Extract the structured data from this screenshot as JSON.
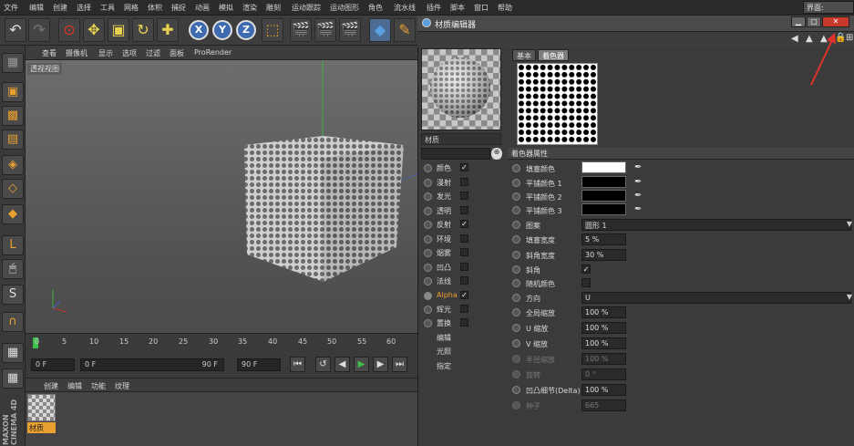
{
  "menubar": {
    "items": [
      "文件",
      "编辑",
      "创建",
      "选择",
      "工具",
      "网格",
      "体积",
      "捕捉",
      "动画",
      "模拟",
      "渲染",
      "雕刻",
      "运动跟踪",
      "运动图形",
      "角色",
      "流水线",
      "插件",
      "脚本",
      "窗口",
      "帮助"
    ],
    "layout_label": "界面:"
  },
  "toolbar": {
    "axis": [
      "X",
      "Y",
      "Z"
    ]
  },
  "viewport": {
    "menu": [
      "查看",
      "摄像机",
      "显示",
      "选项",
      "过滤",
      "面板",
      "ProRender"
    ],
    "label": "透视视图"
  },
  "timeline": {
    "ticks": [
      "0",
      "5",
      "10",
      "15",
      "20",
      "25",
      "30",
      "35",
      "40",
      "45",
      "50",
      "55",
      "60"
    ],
    "start": "0 F",
    "range_start": "0 F",
    "range_end": "90 F",
    "end": "90 F"
  },
  "material_manager": {
    "menu": [
      "创建",
      "编辑",
      "功能",
      "纹理"
    ],
    "material_name": "材质"
  },
  "editor": {
    "title": "材质编辑器",
    "material_name": "材质",
    "tabs": [
      "基本",
      "着色器"
    ],
    "shader_section": "着色器属性",
    "channels": [
      {
        "label": "颜色",
        "checked": true
      },
      {
        "label": "漫射",
        "checked": false
      },
      {
        "label": "发光",
        "checked": false
      },
      {
        "label": "透明",
        "checked": false
      },
      {
        "label": "反射",
        "checked": true
      },
      {
        "label": "环境",
        "checked": false
      },
      {
        "label": "烟雾",
        "checked": false
      },
      {
        "label": "凹凸",
        "checked": false
      },
      {
        "label": "法线",
        "checked": false
      },
      {
        "label": "Alpha",
        "checked": true
      },
      {
        "label": "辉光",
        "checked": false
      },
      {
        "label": "置换",
        "checked": false
      },
      {
        "label": "编辑",
        "checked": null
      },
      {
        "label": "光照",
        "checked": null
      },
      {
        "label": "指定",
        "checked": null
      }
    ],
    "props": [
      {
        "label": "填塞颜色",
        "type": "color",
        "color": "#ffffff"
      },
      {
        "label": "平铺颜色 1",
        "type": "color",
        "color": "#000000"
      },
      {
        "label": "平铺颜色 2",
        "type": "color",
        "color": "#000000"
      },
      {
        "label": "平铺颜色 3",
        "type": "color",
        "color": "#000000"
      },
      {
        "label": "图案",
        "type": "dropdown",
        "value": "圆形 1"
      },
      {
        "label": "填塞宽度",
        "type": "num",
        "value": "5 %"
      },
      {
        "label": "斜角宽度",
        "type": "num",
        "value": "30 %"
      },
      {
        "label": "斜角",
        "type": "check",
        "value": "✓"
      },
      {
        "label": "随机颜色",
        "type": "check",
        "value": ""
      },
      {
        "label": "方向",
        "type": "dropdown",
        "value": "U"
      },
      {
        "label": "全局缩放",
        "type": "num",
        "value": "100 %"
      },
      {
        "label": "U 缩放",
        "type": "num",
        "value": "100 %"
      },
      {
        "label": "V 缩放",
        "type": "num",
        "value": "100 %"
      },
      {
        "label": "半径缩放",
        "type": "num",
        "value": "100 %",
        "dim": true
      },
      {
        "label": "旋转",
        "type": "num",
        "value": "0 °",
        "dim": true
      },
      {
        "label": "凹凸细节(Delta)",
        "type": "num",
        "value": "100 %"
      },
      {
        "label": "种子",
        "type": "num",
        "value": "665",
        "dim": true
      }
    ]
  },
  "colors": {
    "accent": "#e8a030",
    "arrow": "#e0332a",
    "axis_blue": "#3e6bb0"
  }
}
